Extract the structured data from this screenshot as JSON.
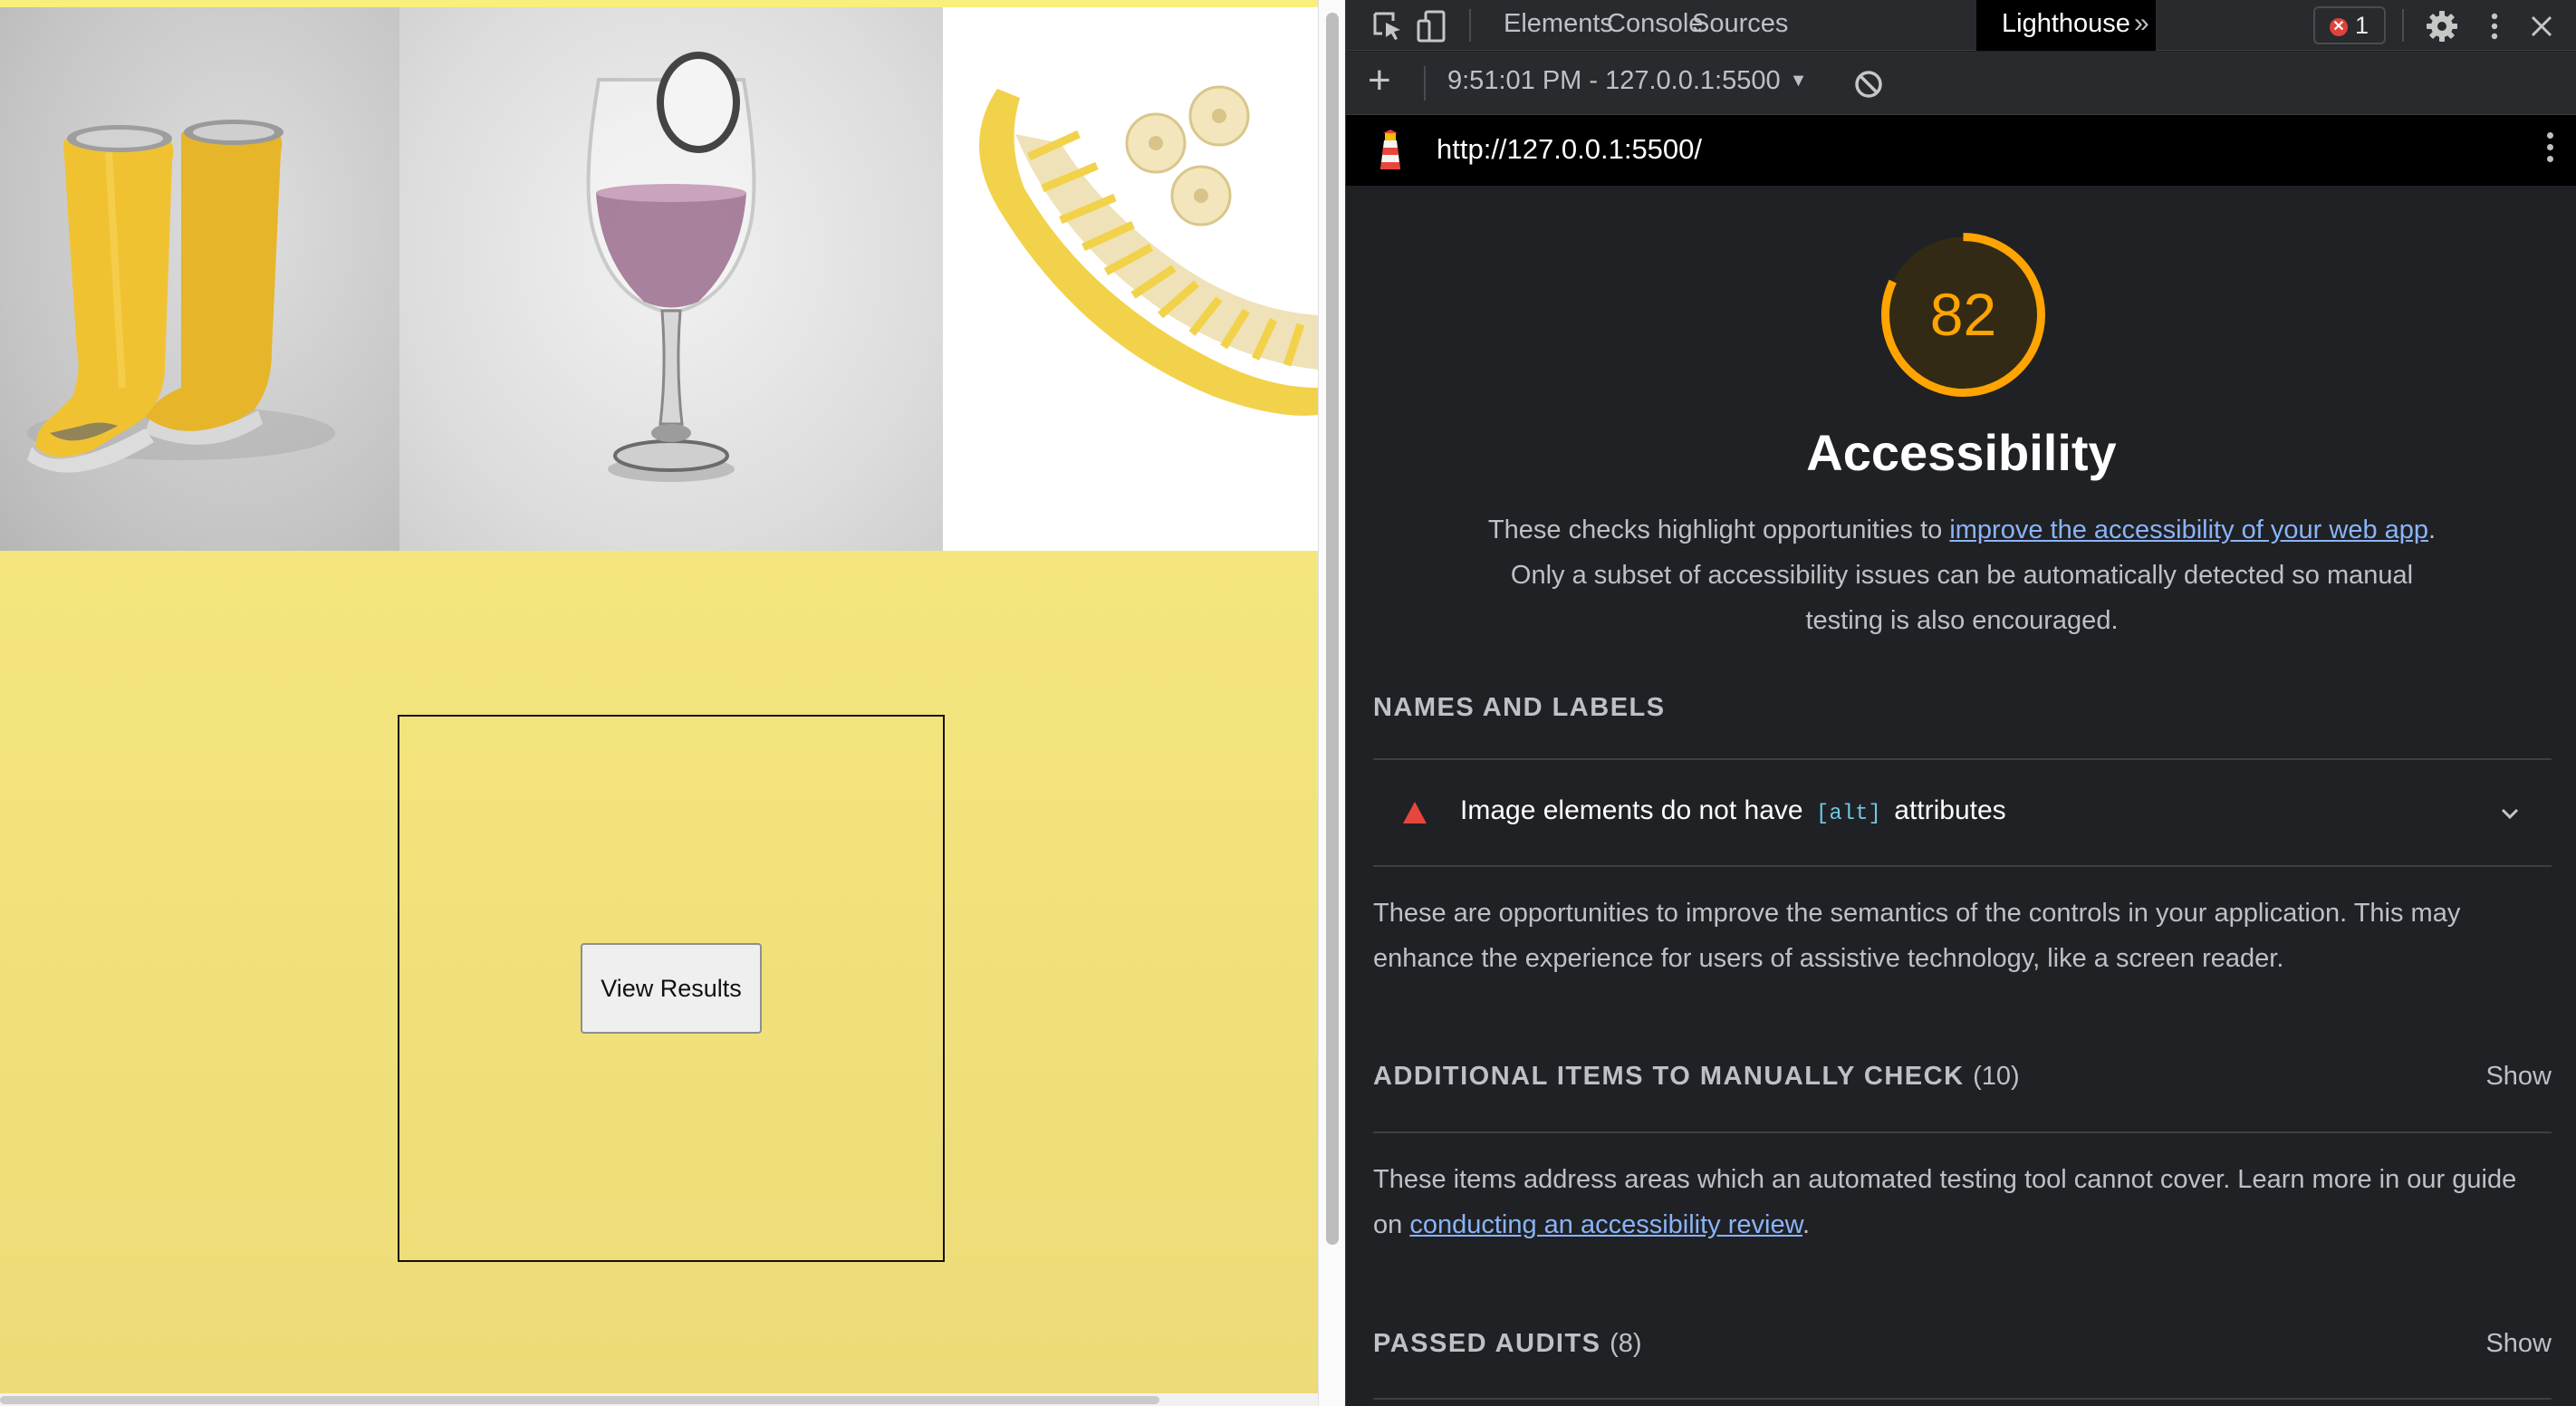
{
  "page": {
    "images": [
      {
        "subject": "yellow rain boots"
      },
      {
        "subject": "wine glass with purple liquid"
      },
      {
        "subject": "banana slicer with banana slices"
      }
    ],
    "view_results_label": "View Results"
  },
  "devtools": {
    "tabs": [
      "Elements",
      "Console",
      "Sources",
      "Lighthouse"
    ],
    "active_tab": "Lighthouse",
    "more_tabs_glyph": "»",
    "error_count": "1",
    "toolbar": {
      "add_glyph": "+",
      "report_label": "9:51:01 PM - 127.0.0.1:5500",
      "caret": "▼"
    },
    "url": "http://127.0.0.1:5500/",
    "icons": [
      "inspect-icon",
      "device-toggle-icon",
      "settings-gear-icon",
      "kebab-menu-icon",
      "close-icon",
      "lighthouse-icon",
      "clear-icon"
    ],
    "colors": {
      "score": "#ffa400",
      "fail": "#e8453c",
      "link": "#8ab4f8"
    }
  },
  "report": {
    "score": "82",
    "score_value": 82,
    "category": "Accessibility",
    "intro_before": "These checks highlight opportunities to ",
    "intro_link": "improve the accessibility of your web app",
    "intro_after": ". Only a subset of accessibility issues can be automatically detected so manual testing is also encouraged.",
    "names_heading": "NAMES AND LABELS",
    "audit": {
      "before": "Image elements do not have",
      "code": "[alt]",
      "after": "attributes"
    },
    "names_description": "These are opportunities to improve the semantics of the controls in your application. This may enhance the experience for users of assistive technology, like a screen reader.",
    "manual_heading": "ADDITIONAL ITEMS TO MANUALLY CHECK",
    "manual_count": "(10)",
    "manual_show": "Show",
    "manual_desc_before": "These items address areas which an automated testing tool cannot cover. Learn more in our guide on ",
    "manual_link": "conducting an accessibility review",
    "manual_desc_after": ".",
    "passed_heading": "PASSED AUDITS",
    "passed_count": "(8)",
    "passed_show": "Show"
  }
}
